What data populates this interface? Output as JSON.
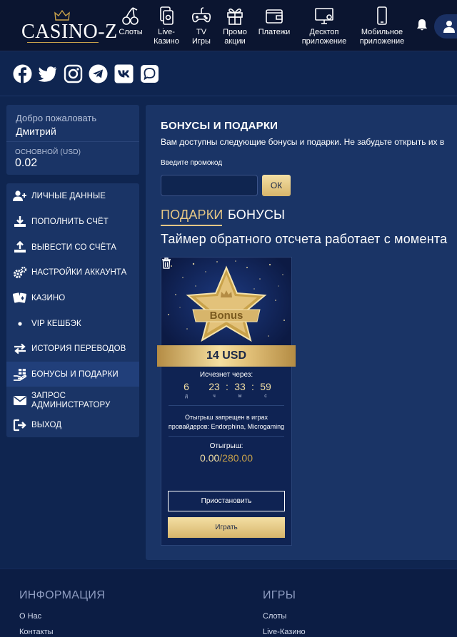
{
  "header": {
    "logo_text": "CASINO-Z",
    "nav": [
      {
        "label": "Слоты",
        "icon": "cherries-icon"
      },
      {
        "label": "Live-Казино",
        "icon": "live-casino-icon"
      },
      {
        "label": "TV Игры",
        "icon": "gamepad-icon"
      },
      {
        "label": "Промо акции",
        "icon": "gift-icon"
      },
      {
        "label": "Платежи",
        "icon": "wallet-icon"
      },
      {
        "label": "Десктоп приложение",
        "icon": "monitor-icon"
      },
      {
        "label": "Мобильное приложение",
        "icon": "phone-icon"
      }
    ],
    "nav_lines": {
      "live": [
        "Live-",
        "Казино"
      ],
      "tv": [
        "TV",
        "Игры"
      ],
      "promo": [
        "Промо",
        "акции"
      ],
      "desktop": [
        "Десктоп",
        "приложение"
      ],
      "mobile": [
        "Мобильное",
        "приложение"
      ]
    }
  },
  "social": [
    "facebook-icon",
    "twitter-icon",
    "instagram-icon",
    "telegram-icon",
    "vk-icon",
    "chat-icon"
  ],
  "account": {
    "welcome_label": "Добро пожаловать",
    "user_name": "Дмитрий",
    "balance_label": "ОСНОВНОЙ (USD)",
    "balance_value": "0.02"
  },
  "menu": {
    "personal": "ЛИЧНЫЕ ДАННЫЕ",
    "deposit": "ПОПОЛНИТЬ СЧЁТ",
    "withdraw": "ВЫВЕСТИ СО СЧЁТА",
    "settings": "НАСТРОЙКИ АККАУНТА",
    "casino": "КАЗИНО",
    "vip": "VIP КЕШБЭК",
    "history": "ИСТОРИЯ ПЕРЕВОДОВ",
    "bonuses": "БОНУСЫ И ПОДАРКИ",
    "request_1": "ЗАПРОС",
    "request_2": "АДМИНИСТРАТОРУ",
    "logout": "ВЫХОД"
  },
  "main": {
    "title": "БОНУСЫ И ПОДАРКИ",
    "subtitle": "Вам доступны следующие бонусы и подарки. Не забудьте открыть их в",
    "promo_label": "Введите промокод",
    "promo_value": "",
    "ok_label": "ОК",
    "tab_gifts": "ПОДАРКИ",
    "tab_bonuses": "БОНУСЫ",
    "timer_text": "Таймер обратного отсчета работает с момента"
  },
  "bonus_card": {
    "badge_text": "Bonus",
    "amount": "14 USD",
    "expire_label": "Исчезнет через:",
    "countdown": {
      "days": "6",
      "hours": "23",
      "minutes": "33",
      "seconds": "59"
    },
    "units": {
      "days": "д",
      "hours": "ч",
      "minutes": "м",
      "seconds": "с"
    },
    "restriction_1": "Отыгрыш запрещен в играх",
    "restriction_2": "провайдеров: Endorphina, Microgaming",
    "wager_label": "Отыгрыш:",
    "wager_current": "0.00",
    "wager_total": "/280.00",
    "pause_label": "Приостановить",
    "play_label": "Играть"
  },
  "footer": {
    "info_title": "ИНФОРМАЦИЯ",
    "info_links": [
      "О Нас",
      "Контакты"
    ],
    "games_title": "ИГРЫ",
    "games_links": [
      "Слоты",
      "Live-Казино"
    ]
  },
  "colors": {
    "accent_gold": "#e6c785",
    "panel": "#1a3466",
    "background": "#0f2550"
  }
}
